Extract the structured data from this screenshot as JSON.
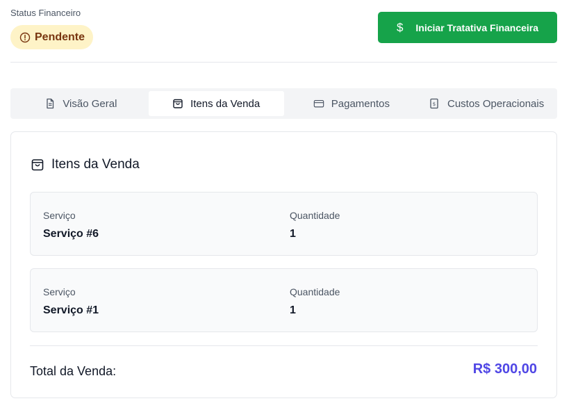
{
  "status": {
    "label": "Status Financeiro",
    "badge": "Pendente",
    "badge_bg": "#fef3c7",
    "badge_color": "#78350f",
    "badge_icon": "alert-circle-icon"
  },
  "action_button": {
    "label": "Iniciar Tratativa Financeira",
    "icon": "$",
    "color": "#16a34a"
  },
  "tabs": [
    {
      "label": "Visão Geral",
      "icon": "file-text-icon",
      "active": false
    },
    {
      "label": "Itens da Venda",
      "icon": "shopping-bag-icon",
      "active": true
    },
    {
      "label": "Pagamentos",
      "icon": "credit-card-icon",
      "active": false
    },
    {
      "label": "Custos Operacionais",
      "icon": "receipt-icon",
      "active": false
    }
  ],
  "card": {
    "title": "Itens da Venda",
    "icon": "shopping-bag-icon",
    "items": [
      {
        "service_label": "Serviço",
        "service_value": "Serviço #6",
        "qty_label": "Quantidade",
        "qty_value": "1"
      },
      {
        "service_label": "Serviço",
        "service_value": "Serviço #1",
        "qty_label": "Quantidade",
        "qty_value": "1"
      }
    ],
    "total_label": "Total da Venda:",
    "total_value": "R$ 300,00",
    "total_color": "#4f46e5"
  }
}
